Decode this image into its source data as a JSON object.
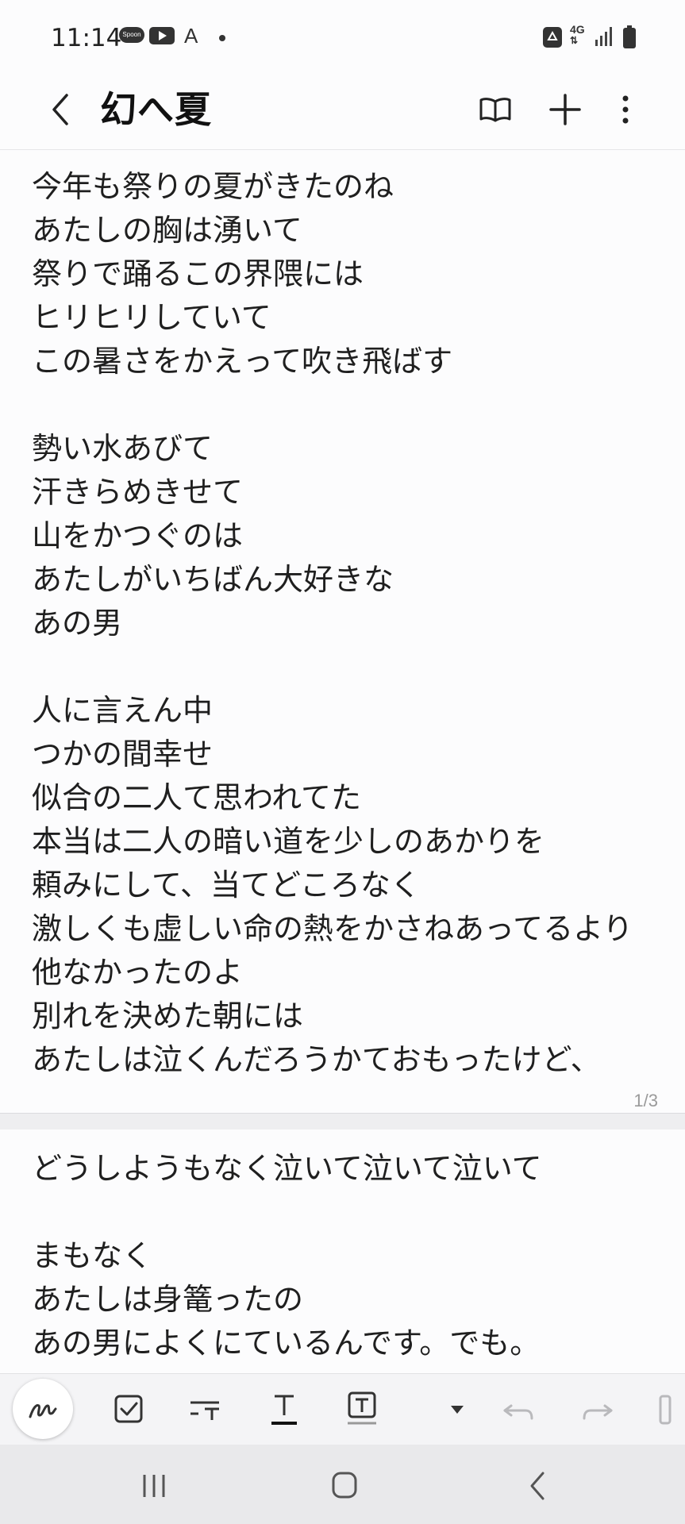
{
  "status_bar": {
    "time": "11:14",
    "app_icons": [
      "spoon-app-icon",
      "youtube-icon",
      "accessibility-a-icon",
      "notification-dot-icon"
    ],
    "spoon_label": "Spoon",
    "a_glyph": "A",
    "network": "4G",
    "right_icons": [
      "recycle-icon",
      "signal-icon",
      "battery-icon"
    ]
  },
  "header": {
    "title": "幻へ夏",
    "actions": [
      "reader-mode-icon",
      "add-icon",
      "more-options-icon"
    ]
  },
  "page1": {
    "lines": [
      "今年も祭りの夏がきたのね",
      "あたしの胸は湧いて",
      "祭りで踊るこの界隈には",
      "ヒリヒリしていて",
      "この暑さをかえって吹き飛ばす",
      "",
      "勢い水あびて",
      "汗きらめきせて",
      "山をかつぐのは",
      "あたしがいちばん大好きな",
      "あの男",
      "",
      "人に言えん中",
      "つかの間幸せ",
      "似合の二人て思われてた",
      "本当は二人の暗い道を少しのあかりを",
      "頼みにして、当てどころなく",
      "激しくも虚しい命の熱をかさねあってるより",
      "他なかったのよ",
      "別れを決めた朝には",
      "あたしは泣くんだろうかておもったけど、"
    ],
    "page_number": "1/3"
  },
  "page2": {
    "lines": [
      "どうしようもなく泣いて泣いて泣いて",
      "",
      "まもなく",
      "あたしは身篭ったの",
      "あの男によくにているんです。でも。"
    ]
  },
  "toolbar": {
    "tools": [
      "pen-icon",
      "checkbox-icon",
      "text-style-icon",
      "text-format-icon",
      "text-box-icon",
      "dropdown-arrow-icon",
      "undo-icon",
      "redo-icon",
      "more-tools-icon"
    ]
  },
  "navbar": {
    "buttons": [
      "recent-apps-icon",
      "home-icon",
      "nav-back-icon"
    ]
  }
}
